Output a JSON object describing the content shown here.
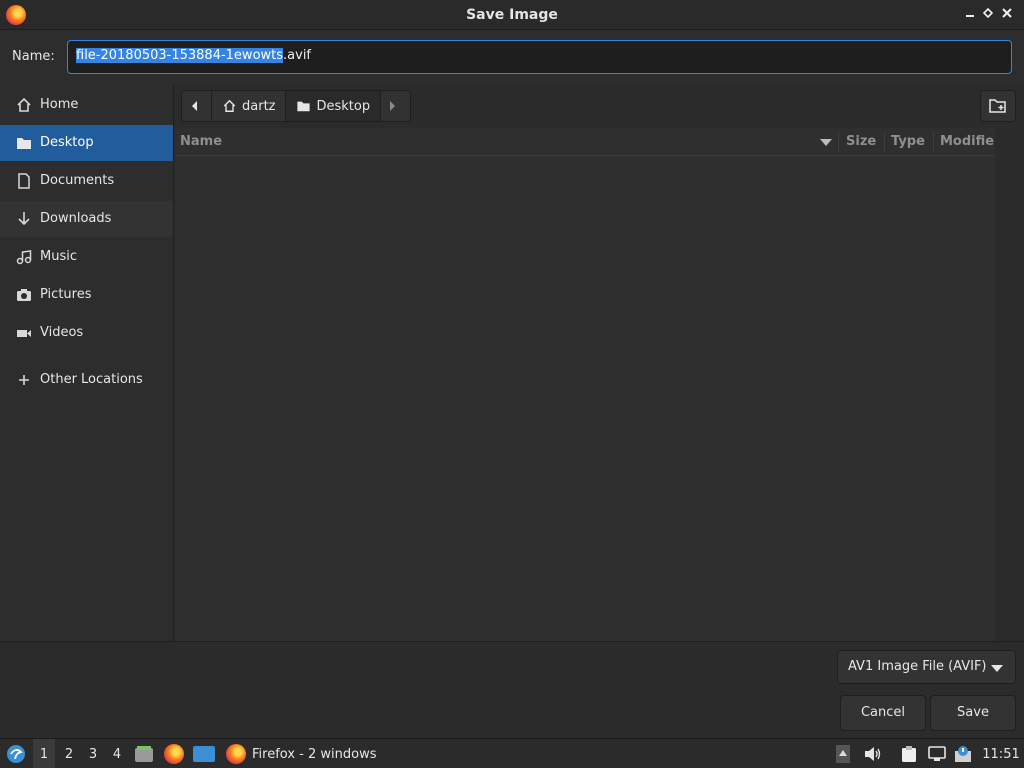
{
  "window": {
    "title": "Save Image",
    "controls": [
      "minimize",
      "maximize",
      "close"
    ]
  },
  "name_field": {
    "label": "Name:",
    "value_selected": "file-20180503-153884-1ewowts",
    "value_rest": ".avif"
  },
  "sidebar": {
    "items": [
      {
        "label": "Home",
        "icon": "home-icon"
      },
      {
        "label": "Desktop",
        "icon": "folder-icon",
        "active": true
      },
      {
        "label": "Documents",
        "icon": "document-icon"
      },
      {
        "label": "Downloads",
        "icon": "download-icon"
      },
      {
        "label": "Music",
        "icon": "music-icon"
      },
      {
        "label": "Pictures",
        "icon": "camera-icon"
      },
      {
        "label": "Videos",
        "icon": "video-icon"
      },
      {
        "label": "Other Locations",
        "icon": "plus-icon"
      }
    ]
  },
  "pathbar": {
    "crumbs": [
      "dartz",
      "Desktop"
    ]
  },
  "file_list": {
    "columns": [
      "Name",
      "Size",
      "Type",
      "Modifie"
    ]
  },
  "filter": {
    "selected": "AV1 Image File (AVIF)"
  },
  "buttons": {
    "cancel": "Cancel",
    "save": "Save"
  },
  "taskbar": {
    "workspaces": [
      "1",
      "2",
      "3",
      "4"
    ],
    "active_workspace": "1",
    "task_label": "Firefox - 2 windows",
    "clock": "11:51"
  },
  "colors": {
    "accent": "#3584e4",
    "sidebar_active": "#215d9c"
  }
}
